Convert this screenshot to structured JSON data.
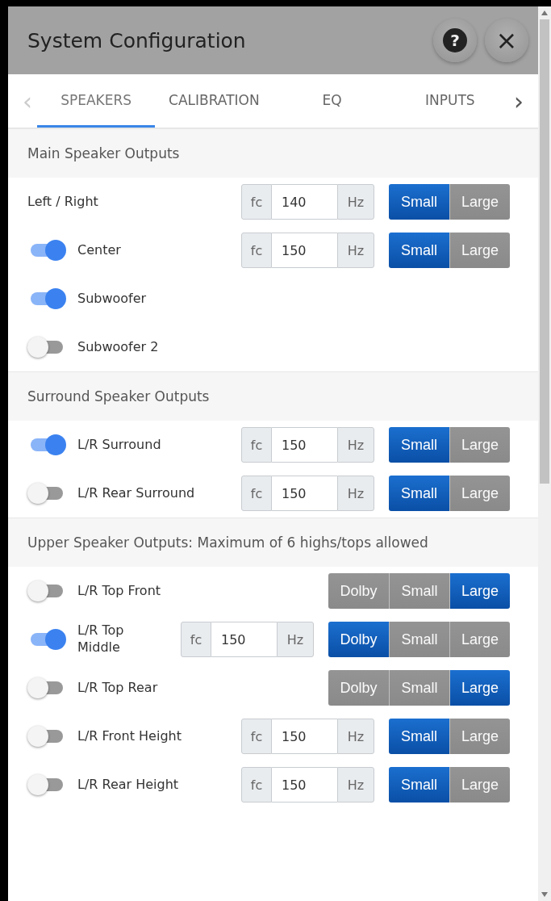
{
  "dialog": {
    "title": "System Configuration",
    "help_label": "?",
    "close_label": "×"
  },
  "tabs": {
    "prev": "‹",
    "next": "›",
    "items": [
      {
        "label": "SPEAKERS",
        "selected": true
      },
      {
        "label": "CALIBRATION",
        "selected": false
      },
      {
        "label": "EQ",
        "selected": false
      },
      {
        "label": "INPUTS",
        "selected": false
      }
    ]
  },
  "sections": [
    {
      "title": "Main Speaker Outputs",
      "rows": [
        {
          "kind": "plain",
          "label": "Left / Right",
          "fc": {
            "prefix": "fc",
            "value": "140",
            "unit": "Hz"
          },
          "sizes": [
            {
              "label": "Small",
              "selected": true
            },
            {
              "label": "Large",
              "selected": false
            }
          ]
        },
        {
          "kind": "toggle",
          "on": true,
          "label": "Center",
          "fc": {
            "prefix": "fc",
            "value": "150",
            "unit": "Hz"
          },
          "sizes": [
            {
              "label": "Small",
              "selected": true
            },
            {
              "label": "Large",
              "selected": false
            }
          ]
        },
        {
          "kind": "toggle",
          "on": true,
          "label": "Subwoofer"
        },
        {
          "kind": "toggle",
          "on": false,
          "label": "Subwoofer 2"
        }
      ]
    },
    {
      "title": "Surround Speaker Outputs",
      "rows": [
        {
          "kind": "toggle",
          "on": true,
          "label": "L/R Surround",
          "fc": {
            "prefix": "fc",
            "value": "150",
            "unit": "Hz"
          },
          "sizes": [
            {
              "label": "Small",
              "selected": true
            },
            {
              "label": "Large",
              "selected": false
            }
          ]
        },
        {
          "kind": "toggle",
          "on": false,
          "label": "L/R Rear Surround",
          "fc": {
            "prefix": "fc",
            "value": "150",
            "unit": "Hz"
          },
          "sizes": [
            {
              "label": "Small",
              "selected": true
            },
            {
              "label": "Large",
              "selected": false
            }
          ]
        }
      ]
    },
    {
      "title": "Upper Speaker Outputs: Maximum of 6 highs/tops allowed",
      "rows": [
        {
          "kind": "toggle",
          "on": false,
          "label": "L/R Top Front",
          "sizes": [
            {
              "label": "Dolby",
              "selected": false
            },
            {
              "label": "Small",
              "selected": false
            },
            {
              "label": "Large",
              "selected": true
            }
          ]
        },
        {
          "kind": "toggle",
          "on": true,
          "label": "L/R Top Middle",
          "fc": {
            "prefix": "fc",
            "value": "150",
            "unit": "Hz"
          },
          "sizes": [
            {
              "label": "Dolby",
              "selected": true
            },
            {
              "label": "Small",
              "selected": false
            },
            {
              "label": "Large",
              "selected": false
            }
          ]
        },
        {
          "kind": "toggle",
          "on": false,
          "label": "L/R Top Rear",
          "sizes": [
            {
              "label": "Dolby",
              "selected": false
            },
            {
              "label": "Small",
              "selected": false
            },
            {
              "label": "Large",
              "selected": true
            }
          ]
        },
        {
          "kind": "toggle",
          "on": false,
          "label": "L/R Front Height",
          "fc": {
            "prefix": "fc",
            "value": "150",
            "unit": "Hz"
          },
          "sizes": [
            {
              "label": "Small",
              "selected": true
            },
            {
              "label": "Large",
              "selected": false
            }
          ]
        },
        {
          "kind": "toggle",
          "on": false,
          "label": "L/R Rear Height",
          "fc": {
            "prefix": "fc",
            "value": "150",
            "unit": "Hz"
          },
          "sizes": [
            {
              "label": "Small",
              "selected": true
            },
            {
              "label": "Large",
              "selected": false
            }
          ]
        }
      ]
    }
  ]
}
